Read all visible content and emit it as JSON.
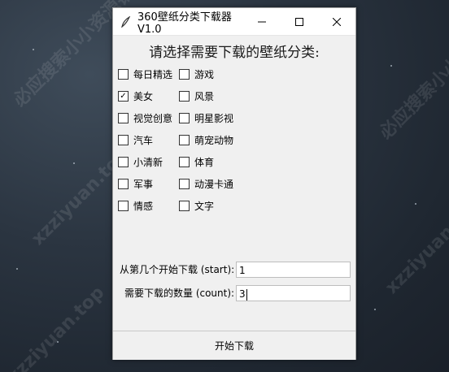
{
  "window": {
    "title": "360壁纸分类下载器V1.0"
  },
  "heading": "请选择需要下载的壁纸分类:",
  "categories_left": [
    {
      "label": "每日精选",
      "checked": false
    },
    {
      "label": "美女",
      "checked": true
    },
    {
      "label": "视觉创意",
      "checked": false
    },
    {
      "label": "汽车",
      "checked": false
    },
    {
      "label": "小清新",
      "checked": false
    },
    {
      "label": "军事",
      "checked": false
    },
    {
      "label": "情感",
      "checked": false
    }
  ],
  "categories_right": [
    {
      "label": "游戏",
      "checked": false
    },
    {
      "label": "风景",
      "checked": false
    },
    {
      "label": "明星影视",
      "checked": false
    },
    {
      "label": "萌宠动物",
      "checked": false
    },
    {
      "label": "体育",
      "checked": false
    },
    {
      "label": "动漫卡通",
      "checked": false
    },
    {
      "label": "文字",
      "checked": false
    }
  ],
  "form": {
    "start_label": "从第几个开始下载 (start):",
    "start_value": "1",
    "count_label": "需要下载的数量 (count):",
    "count_value": "3"
  },
  "start_button": "开始下载",
  "checkmark": "✓",
  "watermarks": [
    "xzziyuan.top",
    "必应搜索小小资源铺"
  ]
}
